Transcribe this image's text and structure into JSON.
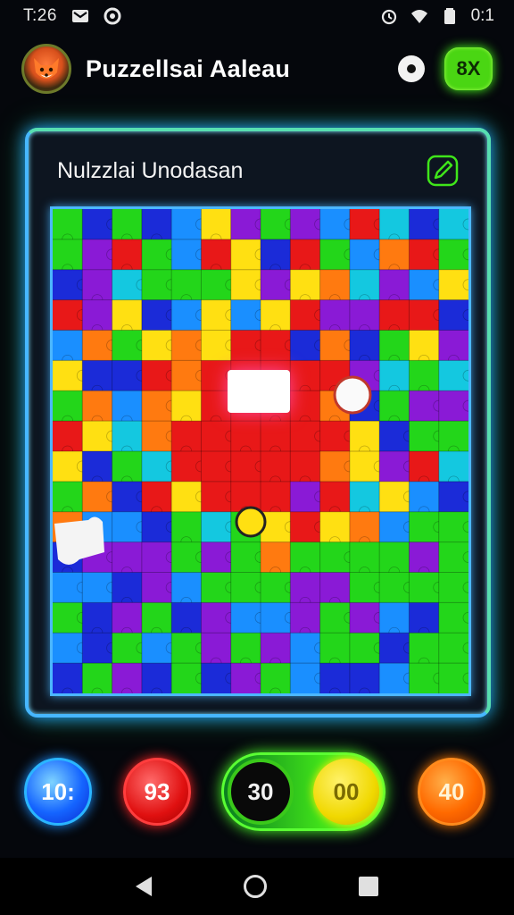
{
  "status": {
    "time": "T:26",
    "clock": "0:1",
    "icons": [
      "gmail-icon",
      "sync-icon",
      "alarm-icon",
      "wifi-icon",
      "battery-icon"
    ]
  },
  "header": {
    "title": "Puzzellsai Aaleau",
    "multiplier_label": "8X",
    "avatar_icon": "fox-avatar-icon",
    "location_icon": "location-icon"
  },
  "panel": {
    "title": "Nulzzlai Unodasan",
    "edit_icon": "pencil-icon"
  },
  "scores": {
    "blue": "10:",
    "red": "93",
    "toggle_left": "30",
    "toggle_right": "00",
    "orange": "40"
  },
  "colors": {
    "accent_green": "#4ad613",
    "panel_border": "#47b7ff",
    "blue": "#1565ff",
    "red": "#e01010",
    "yellow": "#f0d800",
    "orange": "#ff6a00"
  },
  "nav": {
    "back": "back-icon",
    "home": "home-icon",
    "recents": "recents-icon"
  }
}
